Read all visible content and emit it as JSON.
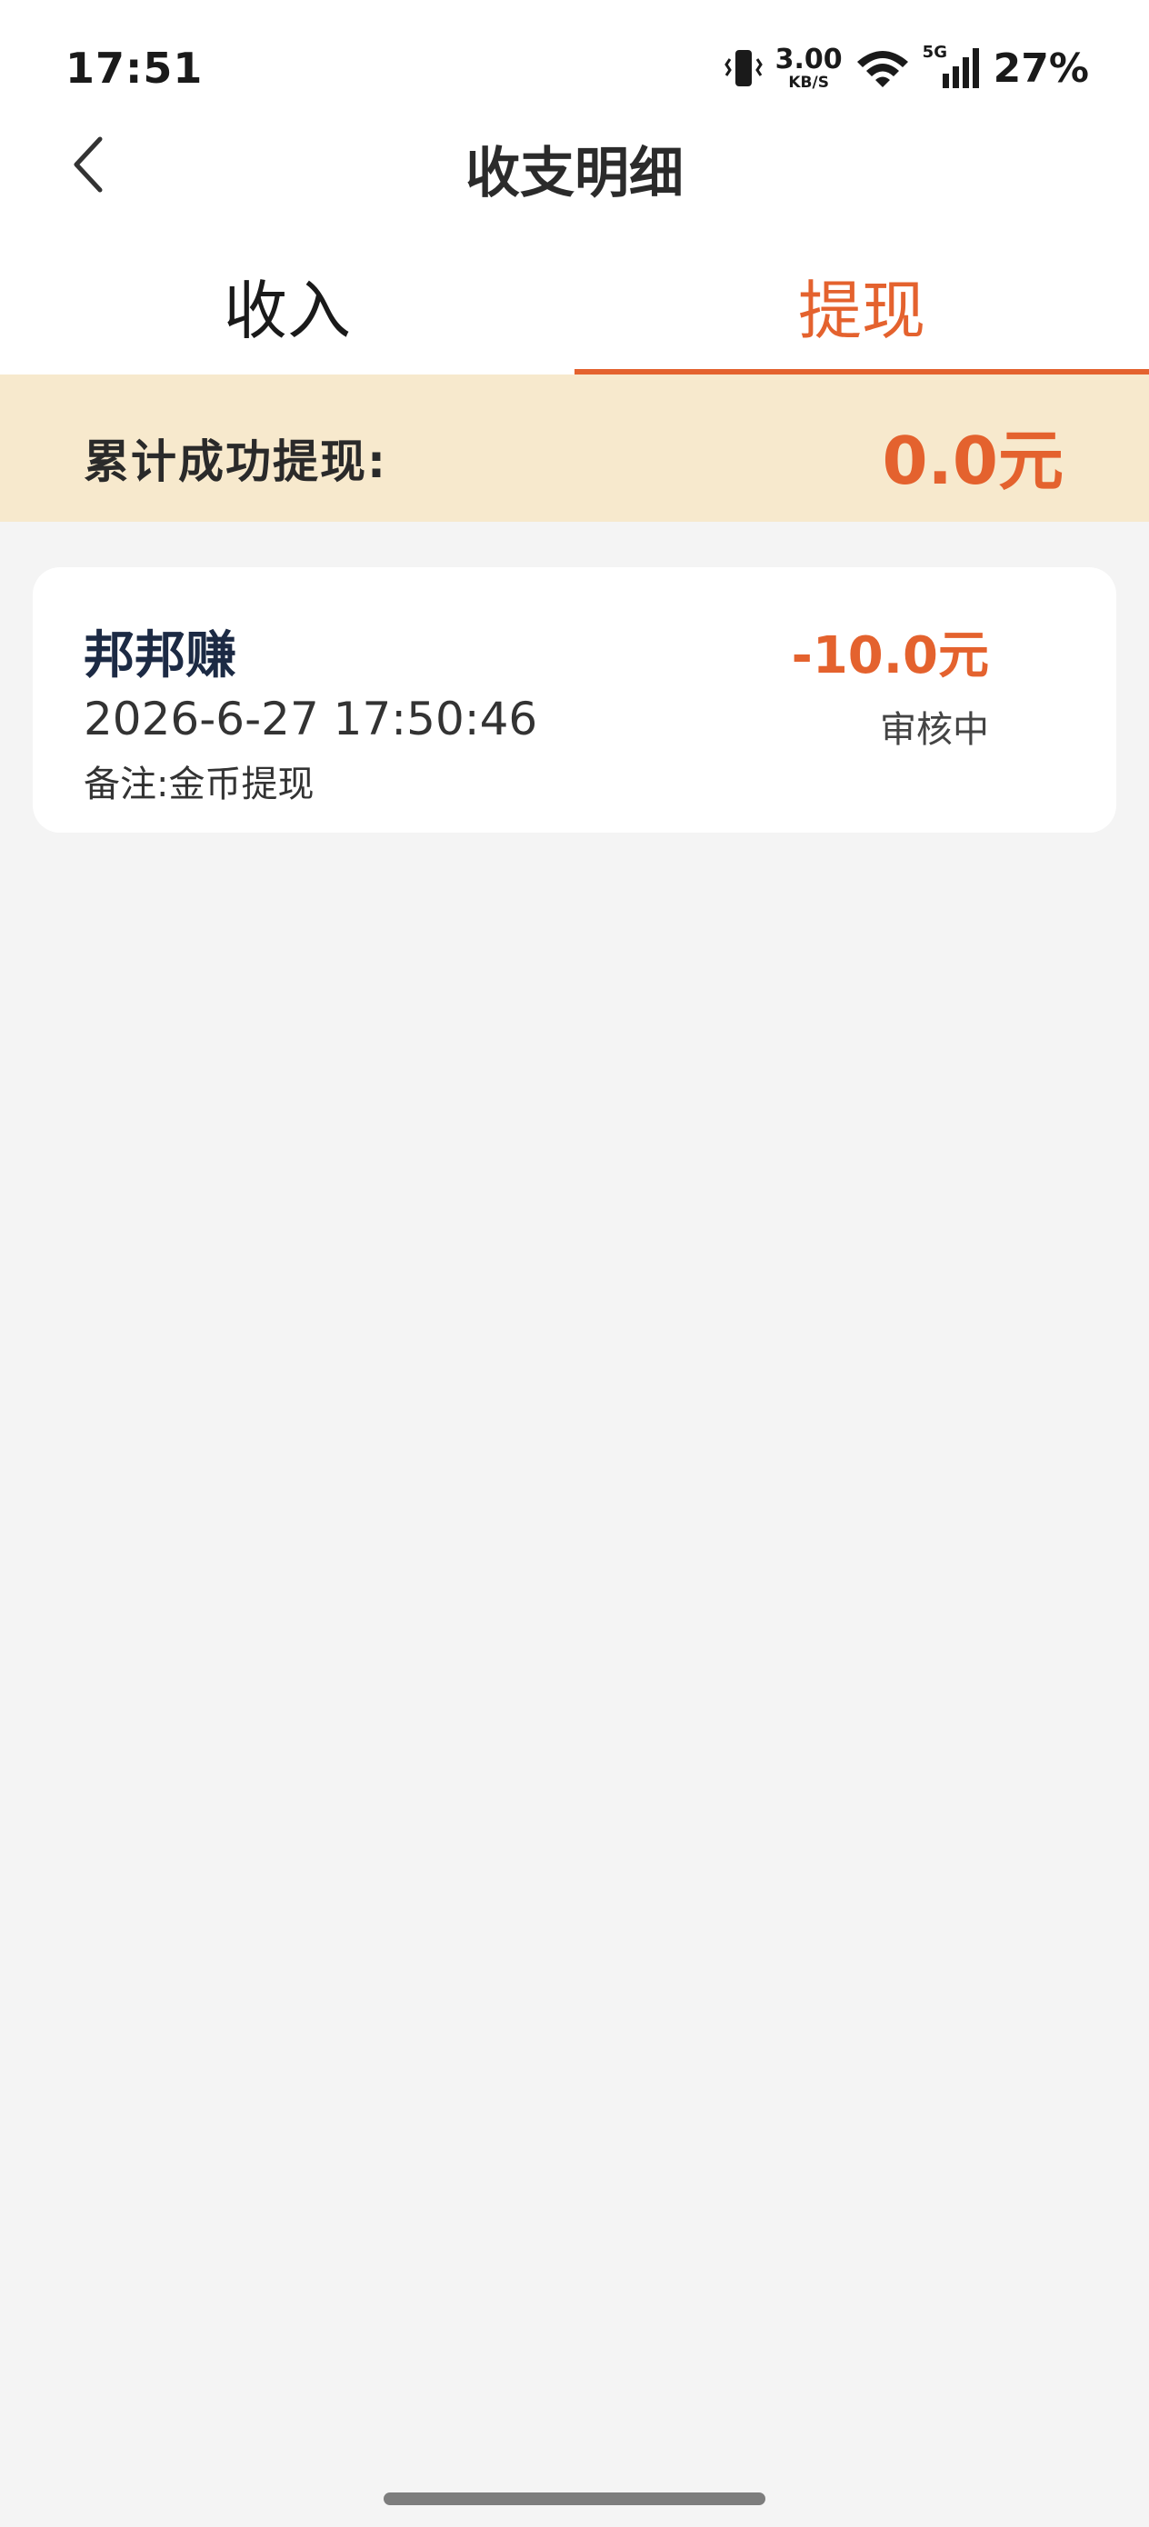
{
  "status_bar": {
    "time": "17:51",
    "net_speed_value": "3.00",
    "net_speed_unit": "KB/S",
    "network_type": "5G",
    "battery": "27%"
  },
  "header": {
    "title": "收支明细",
    "back_icon": "chevron-left-icon"
  },
  "tabs": [
    {
      "label": "收入",
      "active": false
    },
    {
      "label": "提现",
      "active": true
    }
  ],
  "summary": {
    "label": "累计成功提现:",
    "amount": "0.0元"
  },
  "records": [
    {
      "name": "邦邦赚",
      "time": "2026-6-27 17:50:46",
      "note_label": "备注:",
      "note_value": "金币提现",
      "amount": "-10.0元",
      "status": "审核中"
    }
  ],
  "colors": {
    "accent": "#e4622e",
    "summary_bg": "#f7e9cd",
    "page_bg": "#f4f4f4"
  }
}
